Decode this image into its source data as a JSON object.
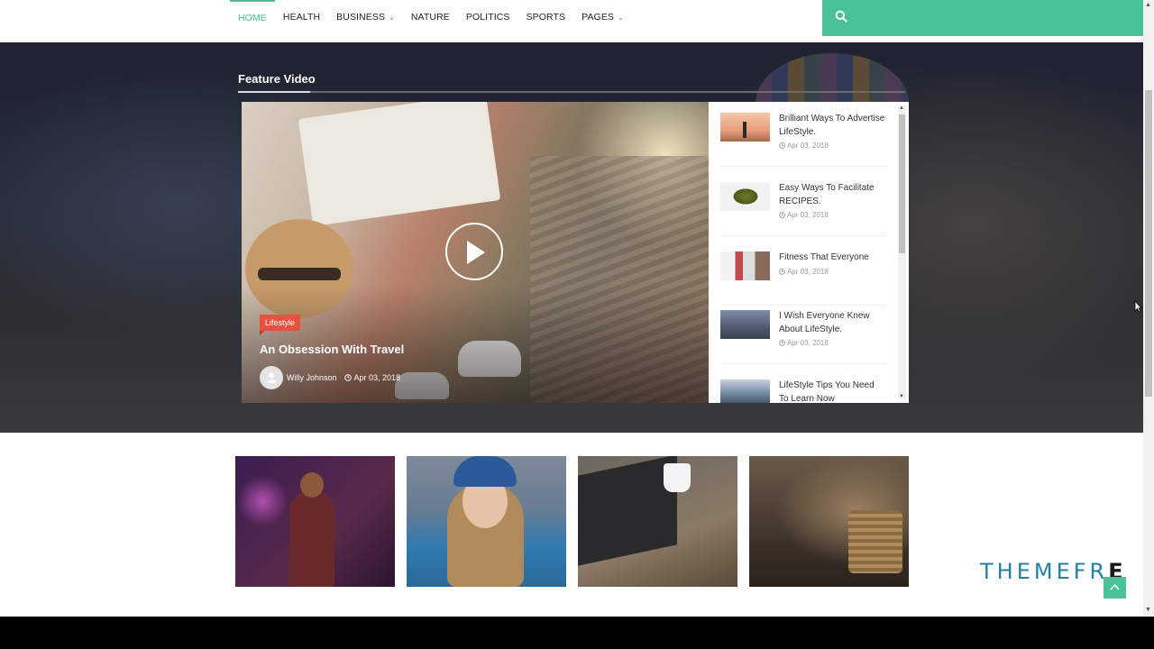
{
  "nav": {
    "items": [
      {
        "label": "HOME",
        "active": true,
        "dropdown": false
      },
      {
        "label": "HEALTH",
        "active": false,
        "dropdown": false
      },
      {
        "label": "BUSINESS",
        "active": false,
        "dropdown": true
      },
      {
        "label": "NATURE",
        "active": false,
        "dropdown": false
      },
      {
        "label": "POLITICS",
        "active": false,
        "dropdown": false
      },
      {
        "label": "SPORTS",
        "active": false,
        "dropdown": false
      },
      {
        "label": "PAGES",
        "active": false,
        "dropdown": true
      }
    ],
    "search_icon": "search-icon",
    "accent_color": "#49c297"
  },
  "feature": {
    "title": "Feature Video",
    "main_video": {
      "category": "Lifestyle",
      "title": "An Obsession With Travel",
      "author": "Willy Johnson",
      "date": "Apr 03, 2018"
    },
    "playlist": [
      {
        "title": "Brilliant Ways To Advertise LifeStyle.",
        "date": "Apr 03, 2018"
      },
      {
        "title": "Easy Ways To Facilitate RECIPES.",
        "date": "Apr 03, 2018"
      },
      {
        "title": "Fitness That Everyone",
        "date": "Apr 03, 2018"
      },
      {
        "title": "I Wish Everyone Knew About LifeStyle.",
        "date": "Apr 03, 2018"
      },
      {
        "title": "LifeStyle Tips You Need To Learn Now",
        "date": ""
      }
    ]
  },
  "brand": {
    "logo_light": "THEMEFR",
    "logo_dark": "E",
    "tag_color": "#e8513f"
  }
}
